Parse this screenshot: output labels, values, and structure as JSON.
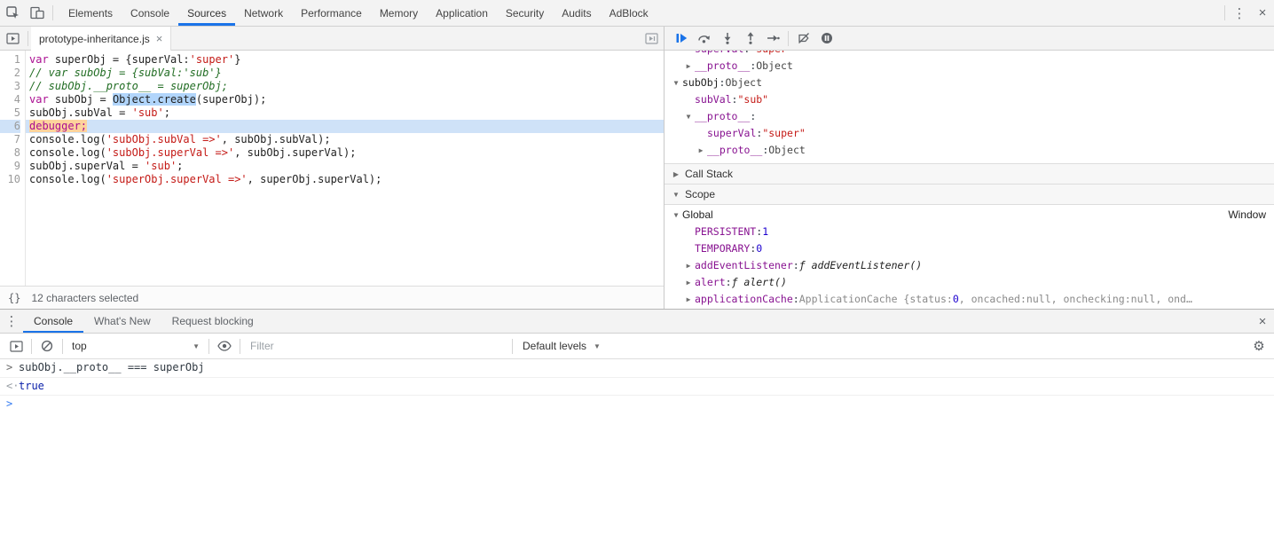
{
  "glyphs": {
    "more": "⋮",
    "close": "×",
    "dropdown_down": "▼",
    "tree_collapsed": "▶",
    "tree_expanded": "▼",
    "gear": "⚙",
    "braces": "{}"
  },
  "devtools": {
    "main_tabs": [
      "Elements",
      "Console",
      "Sources",
      "Network",
      "Performance",
      "Memory",
      "Application",
      "Security",
      "Audits",
      "AdBlock"
    ],
    "active_main_tab": "Sources",
    "left_icons": [
      "inspect-icon",
      "device-toolbar-icon"
    ],
    "right_icons": [
      "more-menu-icon",
      "close-icon"
    ]
  },
  "sources": {
    "file_tab": "prototype-inheritance.js",
    "status_text": "12 characters selected",
    "lines": [
      {
        "num": 1,
        "paused": false,
        "segments": [
          {
            "t": "kw",
            "s": "var"
          },
          {
            "t": "pl",
            "s": " superObj = {superVal:"
          },
          {
            "t": "str",
            "s": "'super'"
          },
          {
            "t": "pl",
            "s": "}"
          }
        ]
      },
      {
        "num": 2,
        "paused": false,
        "segments": [
          {
            "t": "com",
            "s": "// var subObj = {subVal:'sub'}"
          }
        ]
      },
      {
        "num": 3,
        "paused": false,
        "segments": [
          {
            "t": "com",
            "s": "// subObj.__proto__ = superObj;"
          }
        ]
      },
      {
        "num": 4,
        "paused": false,
        "segments": [
          {
            "t": "kw",
            "s": "var"
          },
          {
            "t": "pl",
            "s": " subObj = "
          },
          {
            "t": "sel",
            "s": "Object.create"
          },
          {
            "t": "pl",
            "s": "(superObj);"
          }
        ]
      },
      {
        "num": 5,
        "paused": false,
        "segments": [
          {
            "t": "pl",
            "s": "subObj.subVal = "
          },
          {
            "t": "str",
            "s": "'sub'"
          },
          {
            "t": "pl",
            "s": ";"
          }
        ]
      },
      {
        "num": 6,
        "paused": true,
        "segments": [
          {
            "t": "dbg",
            "s": "debugger;"
          }
        ]
      },
      {
        "num": 7,
        "paused": false,
        "segments": [
          {
            "t": "pl",
            "s": "console.log("
          },
          {
            "t": "str",
            "s": "'subObj.subVal =>'"
          },
          {
            "t": "pl",
            "s": ", subObj.subVal);"
          }
        ]
      },
      {
        "num": 8,
        "paused": false,
        "segments": [
          {
            "t": "pl",
            "s": "console.log("
          },
          {
            "t": "str",
            "s": "'subObj.superVal =>'"
          },
          {
            "t": "pl",
            "s": ", subObj.superVal);"
          }
        ]
      },
      {
        "num": 9,
        "paused": false,
        "segments": [
          {
            "t": "pl",
            "s": "subObj.superVal = "
          },
          {
            "t": "str",
            "s": "'sub'"
          },
          {
            "t": "pl",
            "s": ";"
          }
        ]
      },
      {
        "num": 10,
        "paused": false,
        "segments": [
          {
            "t": "pl",
            "s": "console.log("
          },
          {
            "t": "str",
            "s": "'superObj.superVal =>'"
          },
          {
            "t": "pl",
            "s": ", superObj.superVal);"
          }
        ]
      }
    ]
  },
  "debugger_pane": {
    "toolbar_icons": [
      "resume-icon",
      "step-over-icon",
      "step-into-icon",
      "step-out-icon",
      "step-icon",
      "separator",
      "deactivate-breakpoints-icon",
      "pause-on-exceptions-icon"
    ],
    "watch_rows": [
      {
        "indent": 1,
        "arrow": "",
        "name": "superVal",
        "name_style": "prop",
        "value": [
          {
            "t": "str",
            "s": "\"super\""
          }
        ]
      },
      {
        "indent": 1,
        "arrow": "col",
        "name": "__proto__",
        "name_style": "prop",
        "value": [
          {
            "t": "obj",
            "s": "Object"
          }
        ]
      },
      {
        "indent": 0,
        "arrow": "exp",
        "name": "subObj",
        "name_style": "var",
        "value": [
          {
            "t": "obj",
            "s": "Object"
          }
        ]
      },
      {
        "indent": 1,
        "arrow": "",
        "name": "subVal",
        "name_style": "prop",
        "value": [
          {
            "t": "str",
            "s": "\"sub\""
          }
        ]
      },
      {
        "indent": 1,
        "arrow": "exp",
        "name": "__proto__",
        "name_style": "prop",
        "value": []
      },
      {
        "indent": 2,
        "arrow": "",
        "name": "superVal",
        "name_style": "prop",
        "value": [
          {
            "t": "str",
            "s": "\"super\""
          }
        ]
      },
      {
        "indent": 2,
        "arrow": "col",
        "name": "__proto__",
        "name_style": "prop",
        "value": [
          {
            "t": "obj",
            "s": "Object"
          }
        ]
      }
    ],
    "call_stack": {
      "label": "Call Stack",
      "state": "collapsed"
    },
    "scope": {
      "label": "Scope",
      "state": "expanded",
      "rows": [
        {
          "indent": 0,
          "arrow": "exp",
          "name": "Global",
          "name_style": "scope",
          "value": [],
          "right": "Window"
        },
        {
          "indent": 1,
          "arrow": "",
          "name": "PERSISTENT",
          "name_style": "prop",
          "value": [
            {
              "t": "num",
              "s": "1"
            }
          ]
        },
        {
          "indent": 1,
          "arrow": "",
          "name": "TEMPORARY",
          "name_style": "prop",
          "value": [
            {
              "t": "num",
              "s": "0"
            }
          ]
        },
        {
          "indent": 1,
          "arrow": "col",
          "name": "addEventListener",
          "name_style": "prop",
          "value": [
            {
              "t": "fn",
              "s": "ƒ addEventListener()"
            }
          ]
        },
        {
          "indent": 1,
          "arrow": "col",
          "name": "alert",
          "name_style": "prop",
          "value": [
            {
              "t": "fn",
              "s": "ƒ alert()"
            }
          ]
        },
        {
          "indent": 1,
          "arrow": "col",
          "name": "applicationCache",
          "name_style": "prop",
          "value": [
            {
              "t": "prev",
              "s": "ApplicationCache {status: "
            },
            {
              "t": "num",
              "s": "0"
            },
            {
              "t": "prev",
              "s": ", oncached: "
            },
            {
              "t": "nil",
              "s": "null"
            },
            {
              "t": "prev",
              "s": ", onchecking: "
            },
            {
              "t": "nil",
              "s": "null"
            },
            {
              "t": "prev",
              "s": ", ond…"
            }
          ]
        }
      ]
    }
  },
  "drawer": {
    "tabs": [
      "Console",
      "What's New",
      "Request blocking"
    ],
    "active_tab": "Console",
    "toolbar": {
      "context": "top",
      "filter_placeholder": "Filter",
      "levels_label": "Default levels"
    },
    "messages": [
      {
        "kind": "input",
        "text": "subObj.__proto__ === superObj"
      },
      {
        "kind": "result",
        "text": "true"
      },
      {
        "kind": "prompt",
        "text": ""
      }
    ]
  },
  "colors": {
    "accent_blue": "#1a73e8",
    "paused_line": "#cfe2f8",
    "debugger_token": "#fdd39c",
    "selection": "#b1d5fb",
    "keyword": "#aa0d91",
    "string": "#c41a16",
    "comment": "#236e25",
    "number": "#1c00cf",
    "property": "#881391"
  }
}
